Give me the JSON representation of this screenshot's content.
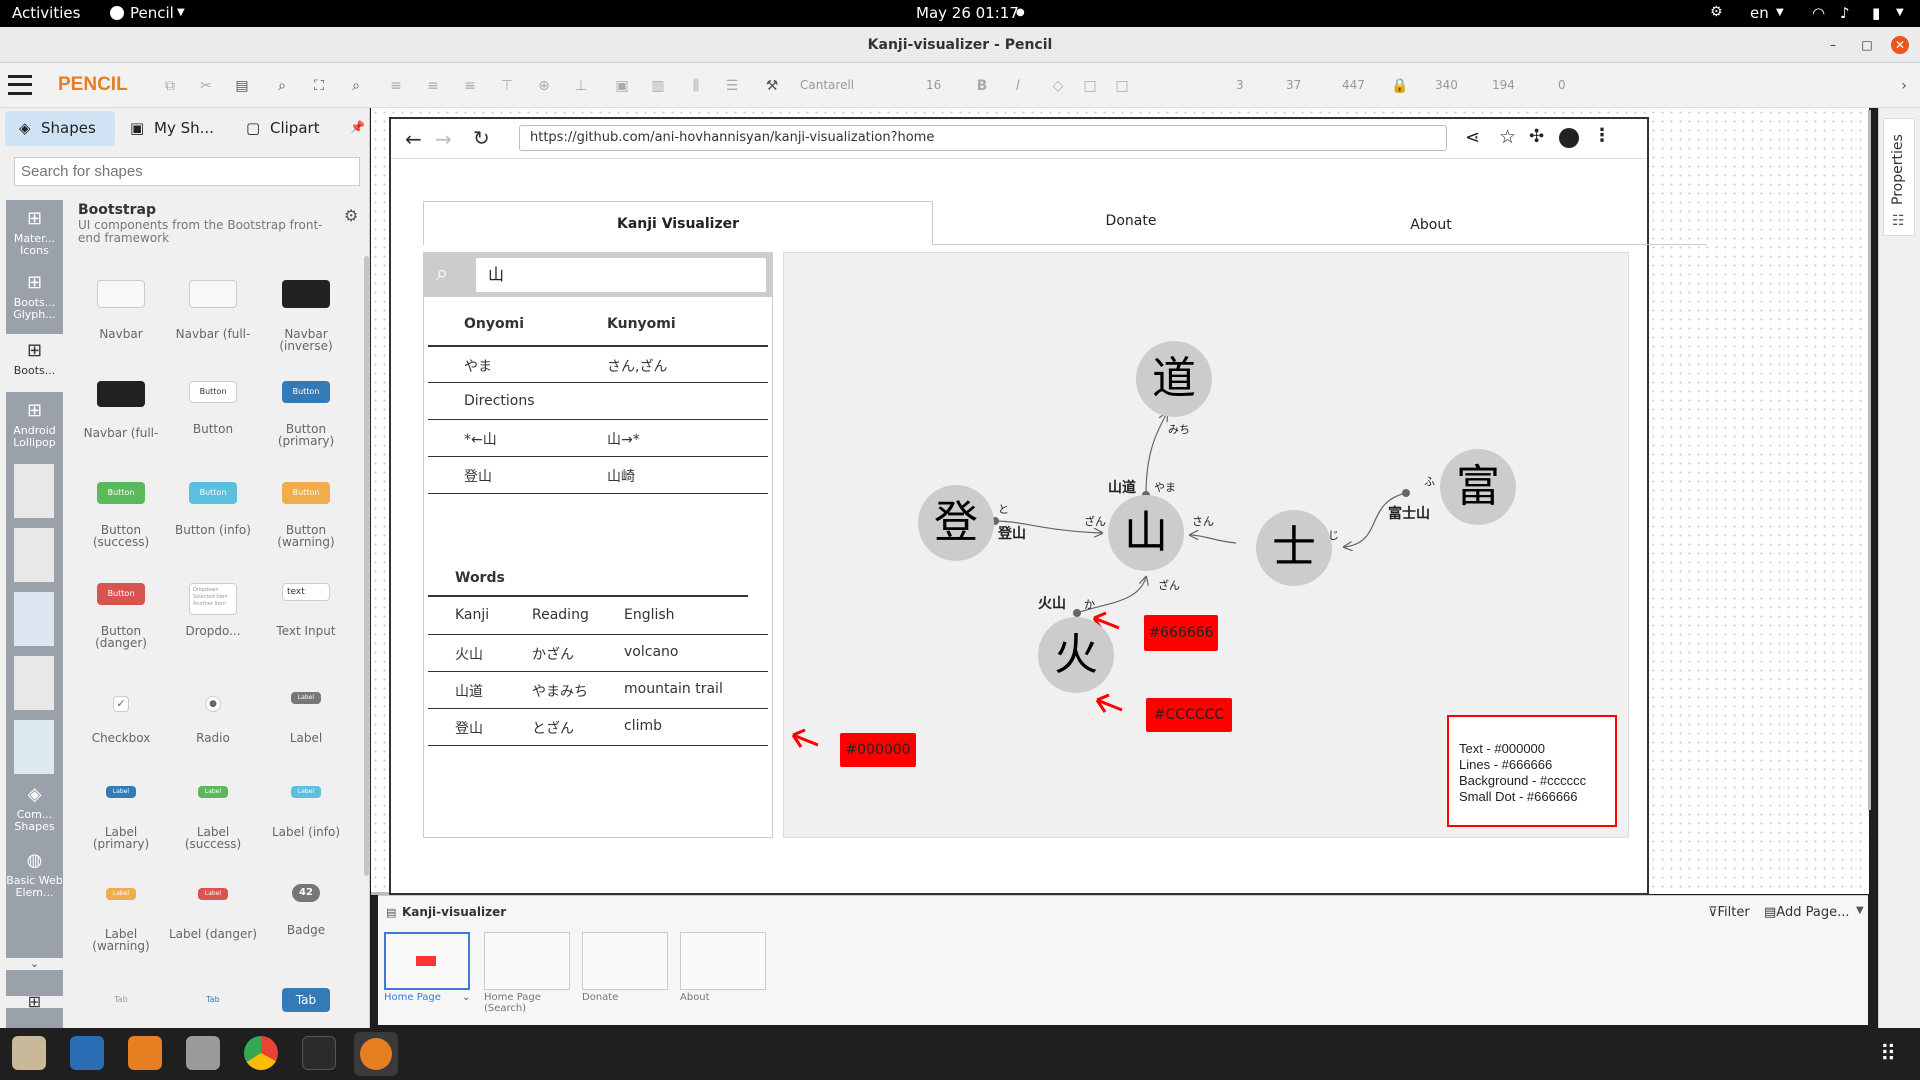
{
  "system": {
    "activities": "Activities",
    "app": "Pencil",
    "datetime": "May 26  01:17",
    "lang": "en"
  },
  "window": {
    "title": "Kanji-visualizer - Pencil"
  },
  "toolbar": {
    "logo": "PENCIL",
    "font": "Cantarell",
    "font_size": "16",
    "stroke": "3",
    "x": "37",
    "y": "447",
    "w": "340",
    "h": "194",
    "angle": "0"
  },
  "left_panel": {
    "tabs": [
      {
        "label": "Shapes"
      },
      {
        "label": "My Sh..."
      },
      {
        "label": "Clipart"
      }
    ],
    "search_placeholder": "Search for shapes",
    "collection_title": "Bootstrap",
    "collection_desc": "UI components from the Bootstrap front-end framework",
    "categories": [
      {
        "label": "Mater... Icons"
      },
      {
        "label": "Boots... Glyph..."
      },
      {
        "label": "Boots..."
      },
      {
        "label": "Android Lollipop"
      },
      {
        "label": "Com... Shapes"
      },
      {
        "label": "Basic Web Elem..."
      }
    ],
    "shapes": [
      {
        "label": "Navbar"
      },
      {
        "label": "Navbar (full-"
      },
      {
        "label": "Navbar (inverse)"
      },
      {
        "label": "Navbar (full-"
      },
      {
        "label": "Button"
      },
      {
        "label": "Button (primary)"
      },
      {
        "label": "Button (success)"
      },
      {
        "label": "Button (info)"
      },
      {
        "label": "Button (warning)"
      },
      {
        "label": "Button (danger)"
      },
      {
        "label": "Dropdo..."
      },
      {
        "label": "Text Input"
      },
      {
        "label": "Checkbox"
      },
      {
        "label": "Radio"
      },
      {
        "label": "Label"
      },
      {
        "label": "Label (primary)"
      },
      {
        "label": "Label (success)"
      },
      {
        "label": "Label (info)"
      },
      {
        "label": "Label (warning)"
      },
      {
        "label": "Label (danger)"
      },
      {
        "label": "Badge"
      }
    ],
    "shape_texts": {
      "button": "Button",
      "text": "text",
      "label": "Label",
      "badge": "42",
      "tab": "Tab",
      "dd1": "Dropdown",
      "dd2": "Selected Item",
      "dd3": "Another Item"
    }
  },
  "browser": {
    "url": "https://github.com/ani-hovhannisyan/kanji-visualization?home"
  },
  "mock": {
    "tabs": [
      {
        "label": "Kanji Visualizer"
      },
      {
        "label": "Donate"
      },
      {
        "label": "About"
      }
    ],
    "search_value": "山",
    "readings_headers": {
      "onyomi": "Onyomi",
      "kunyomi": "Kunyomi"
    },
    "readings": {
      "onyomi": "やま",
      "kunyomi": "さん,ざん"
    },
    "directions_title": "Directions",
    "directions": [
      {
        "a": "*←山",
        "b": "山→*"
      },
      {
        "a": "登山",
        "b": "山崎"
      }
    ],
    "words_title": "Words",
    "words_headers": {
      "kanji": "Kanji",
      "reading": "Reading",
      "english": "English"
    },
    "words": [
      {
        "kanji": "火山",
        "reading": "かざん",
        "english": "volcano"
      },
      {
        "kanji": "山道",
        "reading": "やまみち",
        "english": "mountain trail"
      },
      {
        "kanji": "登山",
        "reading": "とざん",
        "english": "climb"
      }
    ],
    "graph": {
      "nodes": {
        "michi": "道",
        "yama": "山",
        "to": "登",
        "tsuchi": "士",
        "tomi": "富",
        "hi": "火"
      },
      "edge_labels": {
        "michi": "みち",
        "yama_top": "やま",
        "yamamichi": "山道",
        "to": "と",
        "tozan": "登山",
        "zan_left": "ざん",
        "san": "さん",
        "ji": "じ",
        "fu": "ふ",
        "fujisan": "富士山",
        "ka": "か",
        "kazan": "火山",
        "zan_bottom": "ざん"
      }
    },
    "annotations": {
      "c666": "#666666",
      "cccc": "#CCCCCC",
      "c000": "#000000"
    },
    "legend": [
      "Text - #000000",
      "Lines - #666666",
      "Background - #cccccc",
      "Small Dot - #666666"
    ]
  },
  "pages": {
    "doc_title": "Kanji-visualizer",
    "filter": "Filter",
    "add_page": "Add Page...",
    "thumbs": [
      {
        "label": "Home Page"
      },
      {
        "label": "Home Page (Search)"
      },
      {
        "label": "Donate"
      },
      {
        "label": "About"
      }
    ]
  },
  "right_panel": {
    "label": "Properties"
  },
  "colors": {
    "text": "#000000",
    "lines": "#666666",
    "background": "#cccccc",
    "annot": "#ff0000"
  }
}
